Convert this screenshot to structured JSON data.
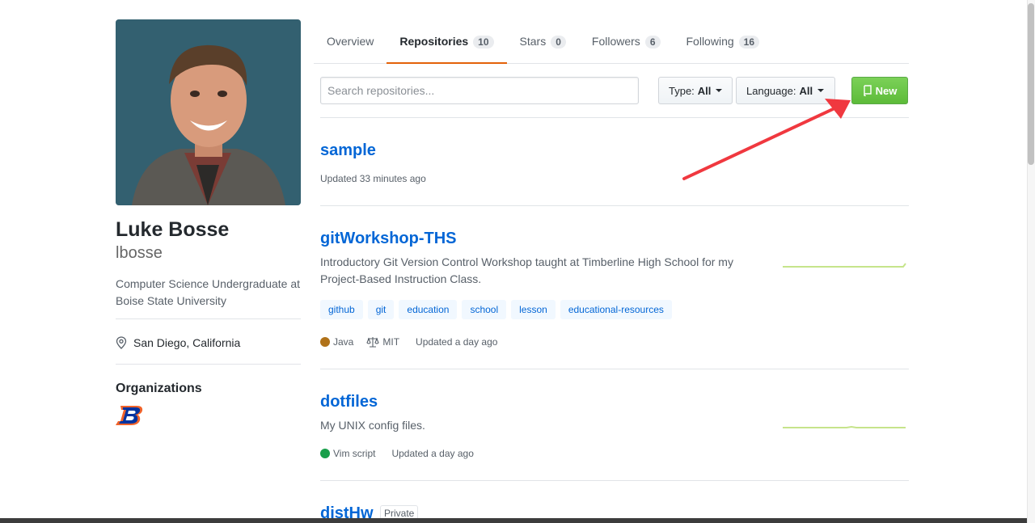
{
  "profile": {
    "full_name": "Luke Bosse",
    "username": "lbosse",
    "bio": "Computer Science Undergraduate at Boise State University",
    "location": "San Diego, California",
    "organizations_title": "Organizations"
  },
  "tabs": [
    {
      "label": "Overview",
      "count": null
    },
    {
      "label": "Repositories",
      "count": "10"
    },
    {
      "label": "Stars",
      "count": "0"
    },
    {
      "label": "Followers",
      "count": "6"
    },
    {
      "label": "Following",
      "count": "16"
    }
  ],
  "filters": {
    "search_placeholder": "Search repositories...",
    "type_label": "Type:",
    "type_value": "All",
    "language_label": "Language:",
    "language_value": "All",
    "new_label": "New"
  },
  "repos": [
    {
      "name": "sample",
      "updated": "Updated 33 minutes ago"
    },
    {
      "name": "gitWorkshop-THS",
      "description": "Introductory Git Version Control Workshop taught at Timberline High School for my Project-Based Instruction Class.",
      "topics": [
        "github",
        "git",
        "education",
        "school",
        "lesson",
        "educational-resources"
      ],
      "language": "Java",
      "language_color": "#b07219",
      "license": "MIT",
      "updated": "Updated a day ago"
    },
    {
      "name": "dotfiles",
      "description": "My UNIX config files.",
      "language": "Vim script",
      "language_color": "#199f4b",
      "updated": "Updated a day ago"
    },
    {
      "name": "distHw",
      "badge": "Private"
    }
  ],
  "colors": {
    "accent_tab": "#e36209",
    "link": "#0366d6",
    "new_button": "#5dbb39",
    "annotation_arrow": "#f0383f"
  }
}
